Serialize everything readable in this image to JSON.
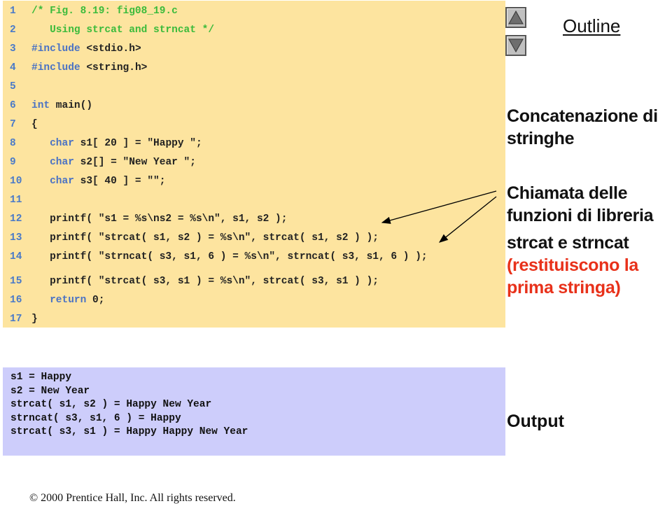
{
  "code": {
    "lines": [
      {
        "num": "1",
        "parts": [
          {
            "t": "/* Fig. 8.19: fig08_19.c",
            "c": "cm"
          }
        ]
      },
      {
        "num": "2",
        "parts": [
          {
            "t": "   Using strcat and strncat */",
            "c": "cm"
          }
        ]
      },
      {
        "num": "3",
        "parts": [
          {
            "t": "#include",
            "c": "kw"
          },
          {
            "t": " <stdio.h>",
            "c": ""
          }
        ]
      },
      {
        "num": "4",
        "parts": [
          {
            "t": "#include",
            "c": "kw"
          },
          {
            "t": " <string.h>",
            "c": ""
          }
        ]
      },
      {
        "num": "5",
        "parts": []
      },
      {
        "num": "6",
        "parts": [
          {
            "t": "int",
            "c": "kw"
          },
          {
            "t": " main()",
            "c": ""
          }
        ]
      },
      {
        "num": "7",
        "parts": [
          {
            "t": "{",
            "c": ""
          }
        ]
      },
      {
        "num": "8",
        "parts": [
          {
            "t": "   ",
            "c": ""
          },
          {
            "t": "char",
            "c": "kw"
          },
          {
            "t": " s1[ 20 ] = \"Happy \";",
            "c": ""
          }
        ]
      },
      {
        "num": "9",
        "parts": [
          {
            "t": "   ",
            "c": ""
          },
          {
            "t": "char",
            "c": "kw"
          },
          {
            "t": " s2[] = \"New Year \";",
            "c": ""
          }
        ]
      },
      {
        "num": "10",
        "parts": [
          {
            "t": "   ",
            "c": ""
          },
          {
            "t": "char",
            "c": "kw"
          },
          {
            "t": " s3[ 40 ] = \"\";",
            "c": ""
          }
        ]
      },
      {
        "num": "11",
        "parts": []
      },
      {
        "num": "12",
        "parts": [
          {
            "t": "   printf( \"s1 = %s\\ns2 = %s\\n\", s1, s2 );",
            "c": ""
          }
        ]
      },
      {
        "num": "13",
        "parts": [
          {
            "t": "   printf( \"strcat( s1, s2 ) = %s\\n\", strcat( s1, s2 ) );",
            "c": ""
          }
        ]
      },
      {
        "num": "14",
        "parts": [
          {
            "t": "   printf( \"strncat( s3, s1, 6 ) = %s\\n\", strncat( s3, s1, 6 ) );",
            "c": ""
          }
        ]
      },
      {
        "num": "15",
        "parts": [
          {
            "t": "   printf( \"strcat( s3, s1 ) = %s\\n\", strcat( s3, s1 ) );",
            "c": ""
          }
        ]
      },
      {
        "num": "16",
        "parts": [
          {
            "t": "   ",
            "c": ""
          },
          {
            "t": "return",
            "c": "kw"
          },
          {
            "t": " 0;",
            "c": ""
          }
        ]
      },
      {
        "num": "17",
        "parts": [
          {
            "t": "}",
            "c": ""
          }
        ]
      }
    ]
  },
  "nav": {
    "up_icon": "triangle-up-icon",
    "down_icon": "triangle-down-icon",
    "outline_label": "Outline"
  },
  "notes": {
    "title_line1": "Concatenazione di",
    "title_line2": "stringhe",
    "call_line1": "Chiamata delle",
    "call_line2": "funzioni di libreria",
    "call_line3": "strcat e strncat",
    "returns_line1": "(restituiscono la",
    "returns_line2": "prima stringa)"
  },
  "output": {
    "label": "Output",
    "lines": [
      "s1 = Happy",
      "s2 = New Year",
      "strcat( s1, s2 ) = Happy New Year",
      "strncat( s3, s1, 6 ) = Happy",
      "strcat( s3, s1 ) = Happy Happy New Year"
    ]
  },
  "footer": {
    "text": "© 2000 Prentice Hall, Inc.  All rights reserved."
  },
  "colors": {
    "code_bg": "#fde49f",
    "output_bg": "#cdcdfb",
    "comment": "#3bbb3b",
    "keyword": "#4a72c4",
    "line_number": "#4a7ac8",
    "highlight_red": "#e8311a"
  }
}
